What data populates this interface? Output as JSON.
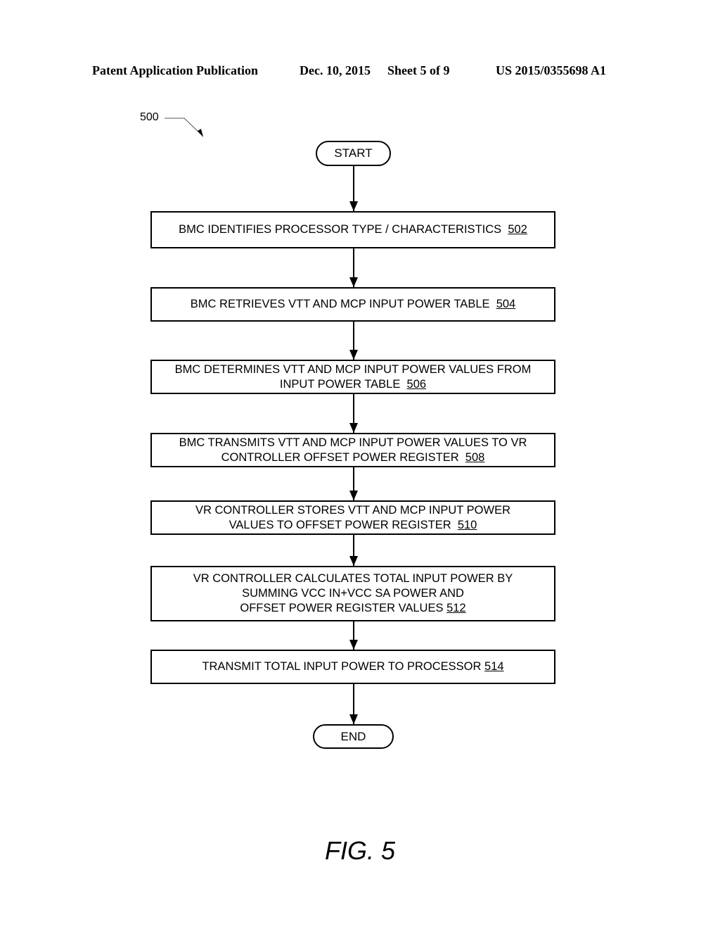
{
  "header": {
    "publication": "Patent Application Publication",
    "date": "Dec. 10, 2015",
    "sheet": "Sheet 5 of 9",
    "number": "US 2015/0355698 A1"
  },
  "figure": {
    "reference": "500",
    "caption": "FIG. 5"
  },
  "flowchart": {
    "start_label": "START",
    "end_label": "END",
    "steps": [
      {
        "lines": [
          "BMC IDENTIFIES PROCESSOR TYPE / CHARACTERISTICS"
        ],
        "num": "502"
      },
      {
        "lines": [
          "BMC RETRIEVES VTT AND MCP INPUT POWER TABLE"
        ],
        "num": "504"
      },
      {
        "lines": [
          "BMC DETERMINES VTT AND MCP INPUT POWER VALUES FROM",
          "INPUT POWER TABLE"
        ],
        "num": "506"
      },
      {
        "lines": [
          "BMC TRANSMITS VTT AND MCP INPUT POWER VALUES TO VR",
          "CONTROLLER OFFSET POWER REGISTER"
        ],
        "num": "508"
      },
      {
        "lines": [
          "VR CONTROLLER STORES VTT AND MCP INPUT POWER",
          "VALUES TO OFFSET POWER REGISTER"
        ],
        "num": "510"
      },
      {
        "lines": [
          "VR CONTROLLER CALCULATES TOTAL INPUT POWER BY",
          "SUMMING VCC IN+VCC SA POWER AND",
          "OFFSET POWER REGISTER VALUES"
        ],
        "num": "512"
      },
      {
        "lines": [
          "TRANSMIT TOTAL INPUT POWER TO PROCESSOR"
        ],
        "num": "514"
      }
    ]
  }
}
